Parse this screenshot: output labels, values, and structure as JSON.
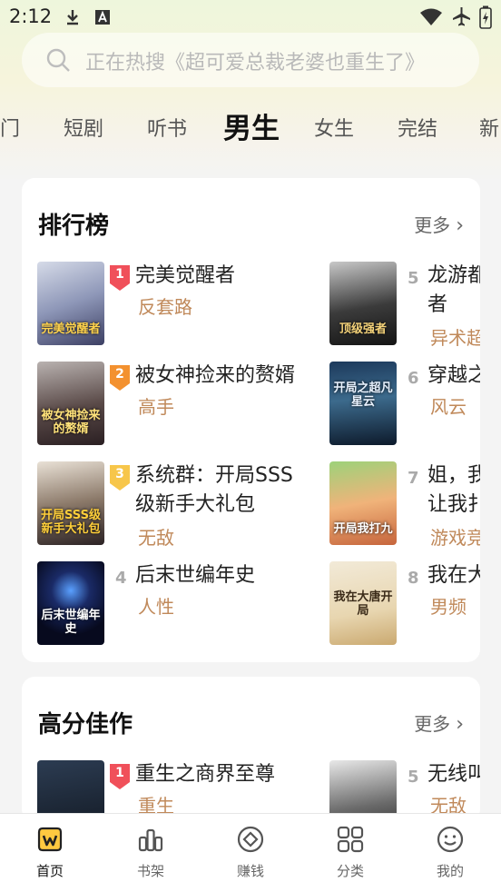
{
  "status_bar": {
    "time": "2:12"
  },
  "search": {
    "placeholder": "正在热搜《超可爱总裁老婆也重生了》"
  },
  "tabs": [
    "门",
    "短剧",
    "听书",
    "男生",
    "女生",
    "完结",
    "新"
  ],
  "ranking": {
    "title": "排行榜",
    "more": "更多",
    "left": [
      {
        "rank": "1",
        "title": "完美觉醒者",
        "tag": "反套路",
        "cover_text": "完美觉醒者"
      },
      {
        "rank": "2",
        "title": "被女神捡来的赘婿",
        "tag": "高手",
        "cover_text": "被女神捡来的赘婿"
      },
      {
        "rank": "3",
        "title_line1": "系统群：开局SSS",
        "title_line2": "级新手大礼包",
        "tag": "无敌",
        "cover_text": "开局SSS级新手大礼包"
      },
      {
        "rank": "4",
        "title": "后末世编年史",
        "tag": "人性",
        "cover_text": "后末世编年史"
      }
    ],
    "right": [
      {
        "rank": "5",
        "title_line1": "龙游都",
        "title_line2": "者",
        "tag": "异术超",
        "cover_text": "顶级强者"
      },
      {
        "rank": "6",
        "title": "穿越之",
        "tag": "风云",
        "cover_text": "开局之超凡星云"
      },
      {
        "rank": "7",
        "title_line1": "姐，我",
        "title_line2": "让我扌",
        "tag": "游戏竞",
        "cover_text": "开局我打九"
      },
      {
        "rank": "8",
        "title": "我在大",
        "tag": "男频",
        "cover_text": "我在大唐开局"
      }
    ]
  },
  "high_score": {
    "title": "高分佳作",
    "more": "更多",
    "left": {
      "rank": "1",
      "title": "重生之商界至尊",
      "tag": "重生"
    },
    "right": {
      "rank": "5",
      "title": "无线叫",
      "tag": "无敌"
    }
  },
  "bottom_nav": [
    "首页",
    "书架",
    "赚钱",
    "分类",
    "我的"
  ],
  "colors": {
    "accent": "#ffc940",
    "tag": "#c0895a",
    "rank1": "#f0505a",
    "rank2": "#f3912f",
    "rank3": "#f7c64a"
  }
}
